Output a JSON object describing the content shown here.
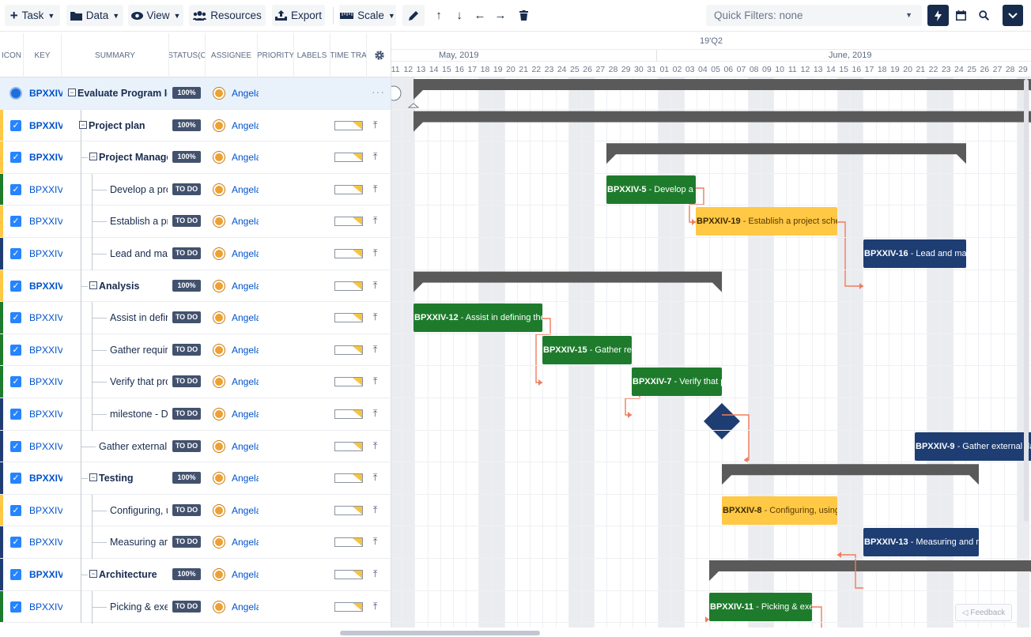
{
  "toolbar": {
    "task_label": "Task",
    "data_label": "Data",
    "view_label": "View",
    "resources_label": "Resources",
    "export_label": "Export",
    "scale_label": "Scale",
    "quick_filters": "Quick Filters: none"
  },
  "grid": {
    "headers": {
      "icon": "ICON",
      "key": "KEY",
      "summary": "SUMMARY",
      "status": "STATUS(C",
      "assignee": "ASSIGNEE",
      "priority": "PRIORITY",
      "labels": "LABELS",
      "time": "TIME TRA"
    },
    "rows": [
      {
        "key": "BPXXIV",
        "summary": "Evaluate Program I-II",
        "status": "100%",
        "assignee": "Angela"
      },
      {
        "key": "BPXXIV",
        "summary": "Project plan",
        "status": "100%",
        "assignee": "Angela"
      },
      {
        "key": "BPXXIV",
        "summary": "Project Management",
        "status": "100%",
        "assignee": "Angela"
      },
      {
        "key": "BPXXIV",
        "summary": "Develop a project",
        "status": "TO DO",
        "assignee": "Angela"
      },
      {
        "key": "BPXXIV",
        "summary": "Establish a project",
        "status": "TO DO",
        "assignee": "Angela"
      },
      {
        "key": "BPXXIV",
        "summary": "Lead and manage",
        "status": "TO DO",
        "assignee": "Angela"
      },
      {
        "key": "BPXXIV",
        "summary": "Analysis",
        "status": "100%",
        "assignee": "Angela"
      },
      {
        "key": "BPXXIV",
        "summary": "Assist in defining",
        "status": "TO DO",
        "assignee": "Angela"
      },
      {
        "key": "BPXXIV",
        "summary": "Gather requirements",
        "status": "TO DO",
        "assignee": "Angela"
      },
      {
        "key": "BPXXIV",
        "summary": "Verify that process",
        "status": "TO DO",
        "assignee": "Angela"
      },
      {
        "key": "BPXXIV",
        "summary": "milestone - Done",
        "status": "TO DO",
        "assignee": "Angela"
      },
      {
        "key": "BPXXIV",
        "summary": "Gather external data",
        "status": "TO DO",
        "assignee": "Angela"
      },
      {
        "key": "BPXXIV",
        "summary": "Testing",
        "status": "100%",
        "assignee": "Angela"
      },
      {
        "key": "BPXXIV",
        "summary": "Configuring, using",
        "status": "TO DO",
        "assignee": "Angela"
      },
      {
        "key": "BPXXIV",
        "summary": "Measuring and",
        "status": "TO DO",
        "assignee": "Angela"
      },
      {
        "key": "BPXXIV",
        "summary": "Architecture",
        "status": "100%",
        "assignee": "Angela"
      },
      {
        "key": "BPXXIV",
        "summary": "Picking & executing",
        "status": "TO DO",
        "assignee": "Angela"
      }
    ]
  },
  "gantt": {
    "quarter": "19'Q2",
    "month1": "May, 2019",
    "month2": "June, 2019",
    "days": [
      "11",
      "12",
      "13",
      "14",
      "15",
      "16",
      "17",
      "18",
      "19",
      "20",
      "21",
      "22",
      "23",
      "24",
      "25",
      "26",
      "27",
      "28",
      "29",
      "30",
      "31",
      "01",
      "02",
      "03",
      "04",
      "05",
      "06",
      "07",
      "08",
      "09",
      "10",
      "11",
      "12",
      "13",
      "14",
      "15",
      "16",
      "17",
      "18",
      "19",
      "20",
      "21",
      "22",
      "23",
      "24",
      "25",
      "26",
      "27",
      "28",
      "29"
    ],
    "bars": [
      {
        "key": "BPXXIV-5",
        "title": " - Develop a project plan",
        "color": "green"
      },
      {
        "key": "BPXXIV-19",
        "title": " - Establish a project schedule",
        "color": "yellow"
      },
      {
        "key": "BPXXIV-16",
        "title": " - Lead and manage",
        "color": "navy"
      },
      {
        "key": "BPXXIV-12",
        "title": " - Assist in defining the",
        "color": "green"
      },
      {
        "key": "BPXXIV-15",
        "title": " - Gather requirements",
        "color": "green"
      },
      {
        "key": "BPXXIV-7",
        "title": " - Verify that process",
        "color": "green"
      },
      {
        "key": "BPXXIV-9",
        "title": " - Gather external data",
        "color": "navy"
      },
      {
        "key": "BPXXIV-8",
        "title": " - Configuring, using,",
        "color": "yellow"
      },
      {
        "key": "BPXXIV-13",
        "title": " - Measuring and reporting",
        "color": "navy"
      },
      {
        "key": "BPXXIV-11",
        "title": " - Picking & executing",
        "color": "green"
      }
    ]
  },
  "feedback_label": "Feedback",
  "colors": {
    "accent": "#2684ff",
    "green": "#1e7b2c",
    "yellow": "#ffc845",
    "navy": "#1e3d73",
    "summary_bar": "#5a5a5a",
    "link": "#f07c5c"
  }
}
